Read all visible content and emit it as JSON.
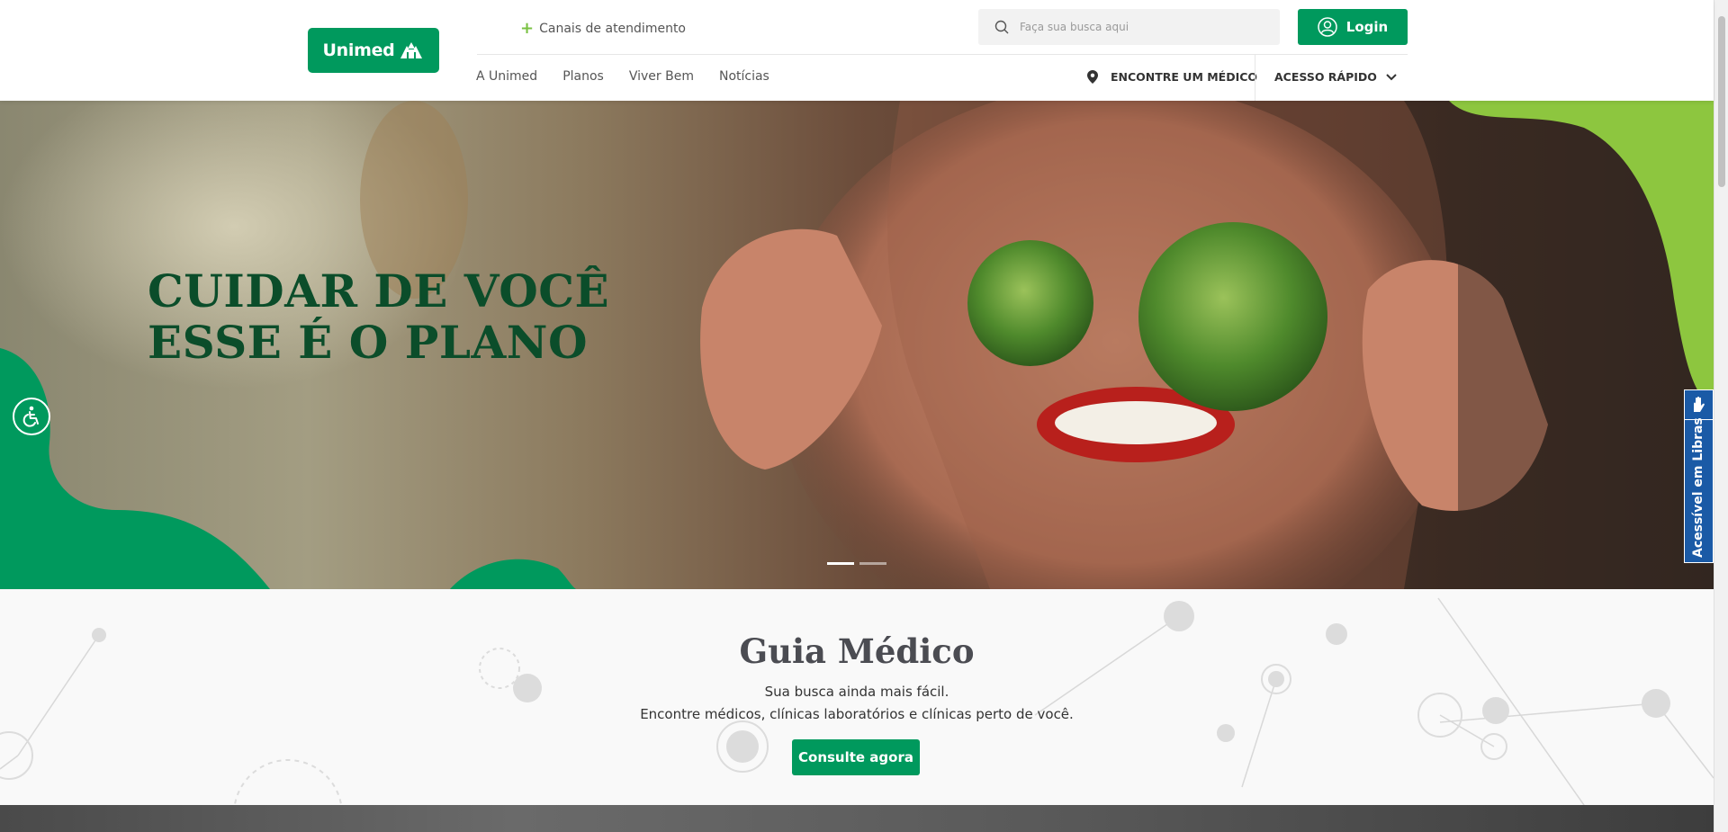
{
  "header": {
    "logo_text": "Unimed",
    "canais_label": "Canais de atendimento",
    "search_placeholder": "Faça sua busca aqui",
    "login_label": "Login",
    "nav": [
      {
        "label": "A Unimed"
      },
      {
        "label": "Planos"
      },
      {
        "label": "Viver Bem"
      },
      {
        "label": "Notícias"
      }
    ],
    "encontre_label": "ENCONTRE UM MÉDICO",
    "acesso_label": "ACESSO RÁPIDO"
  },
  "hero": {
    "line1": "CUIDAR DE VOCÊ",
    "line2": "ESSE É O PLANO",
    "active_slide": 1,
    "slide_count": 2
  },
  "accessibility": {
    "libras_label": "Acessível em Libras"
  },
  "guia": {
    "title": "Guia Médico",
    "subtitle1": "Sua busca ainda mais fácil.",
    "subtitle2": "Encontre médicos, clínicas laboratórios e clínicas perto de você.",
    "button_label": "Consulte agora"
  },
  "colors": {
    "brand_green": "#00995d",
    "light_green": "#7ac143",
    "dark_green": "#0b4d2a",
    "libras_blue": "#1a5aa6"
  }
}
